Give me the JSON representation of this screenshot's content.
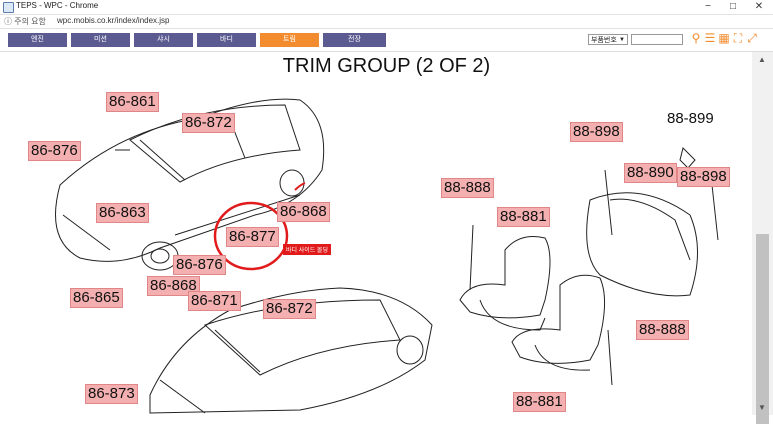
{
  "window": {
    "title": "TEPS - WPC - Chrome",
    "controls": [
      "−",
      "□",
      "✕"
    ]
  },
  "address": {
    "info": "주의 요함",
    "url": "wpc.mobis.co.kr/index/index.jsp"
  },
  "tabs": [
    {
      "label": "엔진"
    },
    {
      "label": "미션"
    },
    {
      "label": "샤시"
    },
    {
      "label": "바디"
    },
    {
      "label": "트림",
      "active": true
    },
    {
      "label": "전장"
    }
  ],
  "search": {
    "select_value": "부품번호",
    "input_value": ""
  },
  "icons": [
    "search-icon",
    "list-icon",
    "grid-icon",
    "fit-icon",
    "expand-icon"
  ],
  "diagram": {
    "title": "TRIM GROUP (2 OF 2)",
    "labels": [
      "86-861",
      "86-872",
      "86-876",
      "86-863",
      "86-868",
      "86-877",
      "86-876",
      "86-868",
      "86-865",
      "86-871",
      "86-872",
      "86-873",
      "88-898",
      "88-899",
      "88-890",
      "88-898",
      "88-888",
      "88-881",
      "88-888",
      "88-881"
    ],
    "annotation": "바디 사이드 몰딩"
  },
  "colors": {
    "tab": "#5b5b92",
    "tab_active": "#f28c2f",
    "label_bg": "#f4b0b0",
    "marker": "#e11b1b"
  }
}
